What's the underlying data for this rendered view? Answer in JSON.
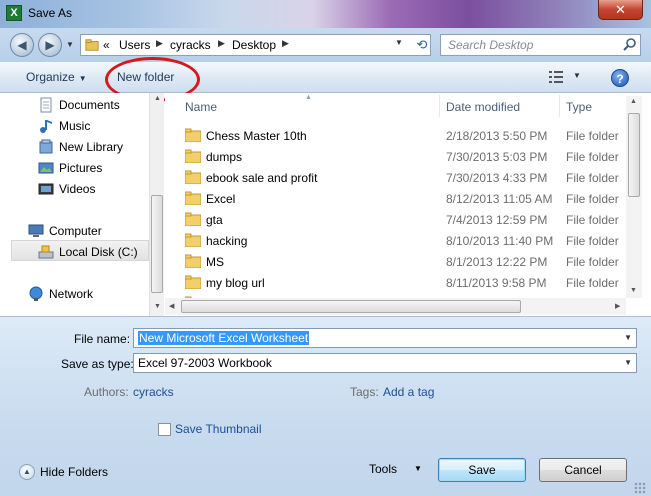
{
  "window": {
    "title": "Save As",
    "app_icon_letter": "X",
    "close_glyph": "✕"
  },
  "address": {
    "overflow": "«",
    "crumbs": [
      "Users",
      "cyracks",
      "Desktop"
    ],
    "search_placeholder": "Search Desktop"
  },
  "toolbar": {
    "organize_label": "Organize",
    "new_folder_label": "New folder",
    "help_glyph": "?"
  },
  "nav_pane": {
    "items": [
      {
        "label": "Documents",
        "icon": "documents-icon"
      },
      {
        "label": "Music",
        "icon": "music-icon"
      },
      {
        "label": "New Library",
        "icon": "library-icon"
      },
      {
        "label": "Pictures",
        "icon": "pictures-icon"
      },
      {
        "label": "Videos",
        "icon": "videos-icon"
      },
      {
        "label": "Computer",
        "icon": "computer-icon"
      },
      {
        "label": "Local Disk (C:)",
        "icon": "local-disk-icon",
        "selected": true
      },
      {
        "label": "Network",
        "icon": "network-icon"
      }
    ]
  },
  "file_list": {
    "columns": {
      "name": "Name",
      "date": "Date modified",
      "type": "Type"
    },
    "rows": [
      {
        "name": "Chess Master 10th",
        "date": "2/18/2013 5:50 PM",
        "type": "File folder"
      },
      {
        "name": "dumps",
        "date": "7/30/2013 5:03 PM",
        "type": "File folder"
      },
      {
        "name": "ebook sale and profit",
        "date": "7/30/2013 4:33 PM",
        "type": "File folder"
      },
      {
        "name": "Excel",
        "date": "8/12/2013 11:05 AM",
        "type": "File folder"
      },
      {
        "name": "gta",
        "date": "7/4/2013 12:59 PM",
        "type": "File folder"
      },
      {
        "name": "hacking",
        "date": "8/10/2013 11:40 PM",
        "type": "File folder"
      },
      {
        "name": "MS",
        "date": "8/1/2013 12:22 PM",
        "type": "File folder"
      },
      {
        "name": "my blog url",
        "date": "8/11/2013 9:58 PM",
        "type": "File folder"
      }
    ]
  },
  "form": {
    "file_name_label": "File name:",
    "file_name_value": "New Microsoft Excel Worksheet",
    "save_as_type_label": "Save as type:",
    "save_as_type_value": "Excel 97-2003 Workbook",
    "authors_label": "Authors:",
    "authors_value": "cyracks",
    "tags_label": "Tags:",
    "tags_value": "Add a tag",
    "save_thumbnail_label": "Save Thumbnail"
  },
  "footer": {
    "hide_folders_label": "Hide Folders",
    "tools_label": "Tools",
    "save_label": "Save",
    "cancel_label": "Cancel"
  }
}
